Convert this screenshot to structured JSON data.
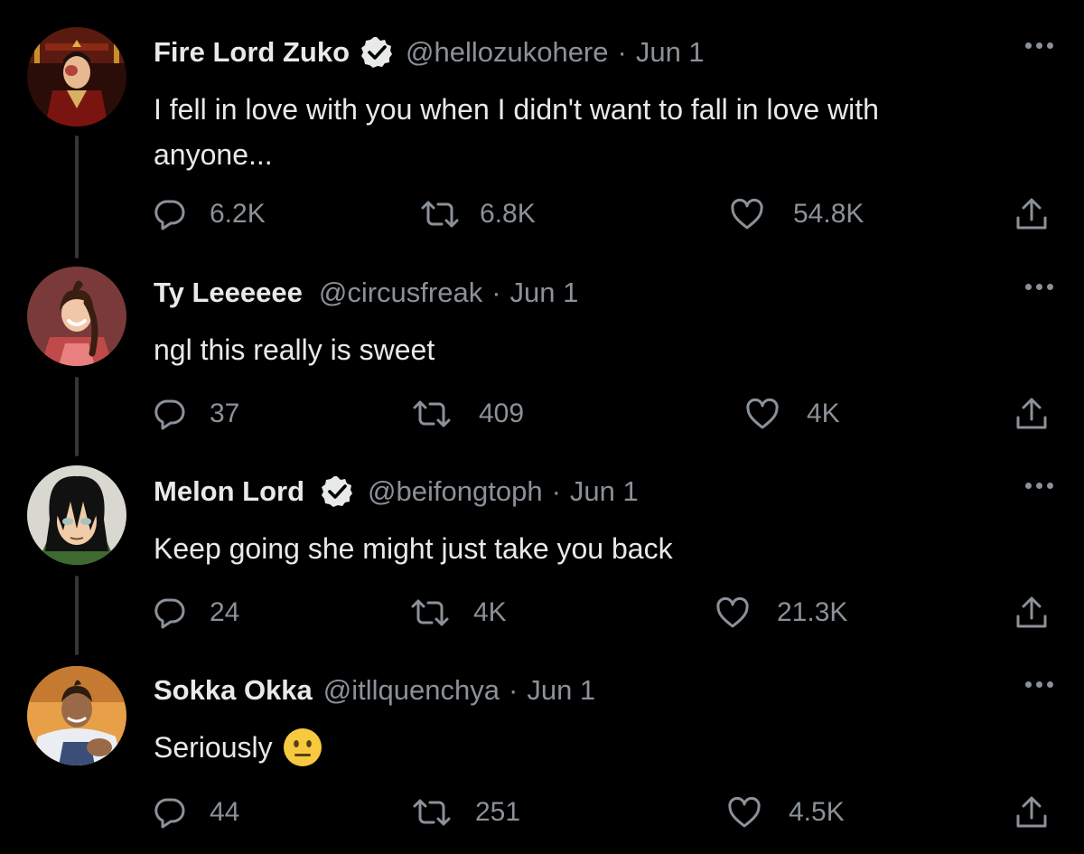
{
  "colors": {
    "background": "#000000",
    "text": "#e7e9ea",
    "secondary": "#8b9198",
    "thread_line": "#333639",
    "verified_badge": "#e7e9ea"
  },
  "tweets": [
    {
      "name": "Fire Lord Zuko",
      "verified": true,
      "handle": "@hellozukohere",
      "separator": "·",
      "date": "Jun 1",
      "text": "I fell in love with you when I didn't want to fall in love with anyone...",
      "emoji": "",
      "replies": "6.2K",
      "retweets": "6.8K",
      "likes": "54.8K"
    },
    {
      "name": "Ty Leeeeee",
      "verified": false,
      "handle": "@circusfreak",
      "separator": "·",
      "date": "Jun 1",
      "text": "ngl this really is sweet",
      "emoji": "",
      "replies": "37",
      "retweets": "409",
      "likes": "4K"
    },
    {
      "name": "Melon Lord",
      "verified": true,
      "handle": "@beifongtoph",
      "separator": "·",
      "date": "Jun 1",
      "text": "Keep going she might just take you back",
      "emoji": "",
      "replies": "24",
      "retweets": "4K",
      "likes": "21.3K"
    },
    {
      "name": "Sokka Okka",
      "verified": false,
      "handle": "@itllquenchya",
      "separator": "·",
      "date": "Jun 1",
      "text": "Seriously",
      "emoji": "neutral-face-emoji",
      "replies": "44",
      "retweets": "251",
      "likes": "4.5K"
    }
  ],
  "icons": {
    "reply": "reply-icon",
    "retweet": "retweet-icon",
    "like": "heart-icon",
    "share": "share-icon",
    "more": "more-icon",
    "verified": "verified-badge-icon"
  }
}
